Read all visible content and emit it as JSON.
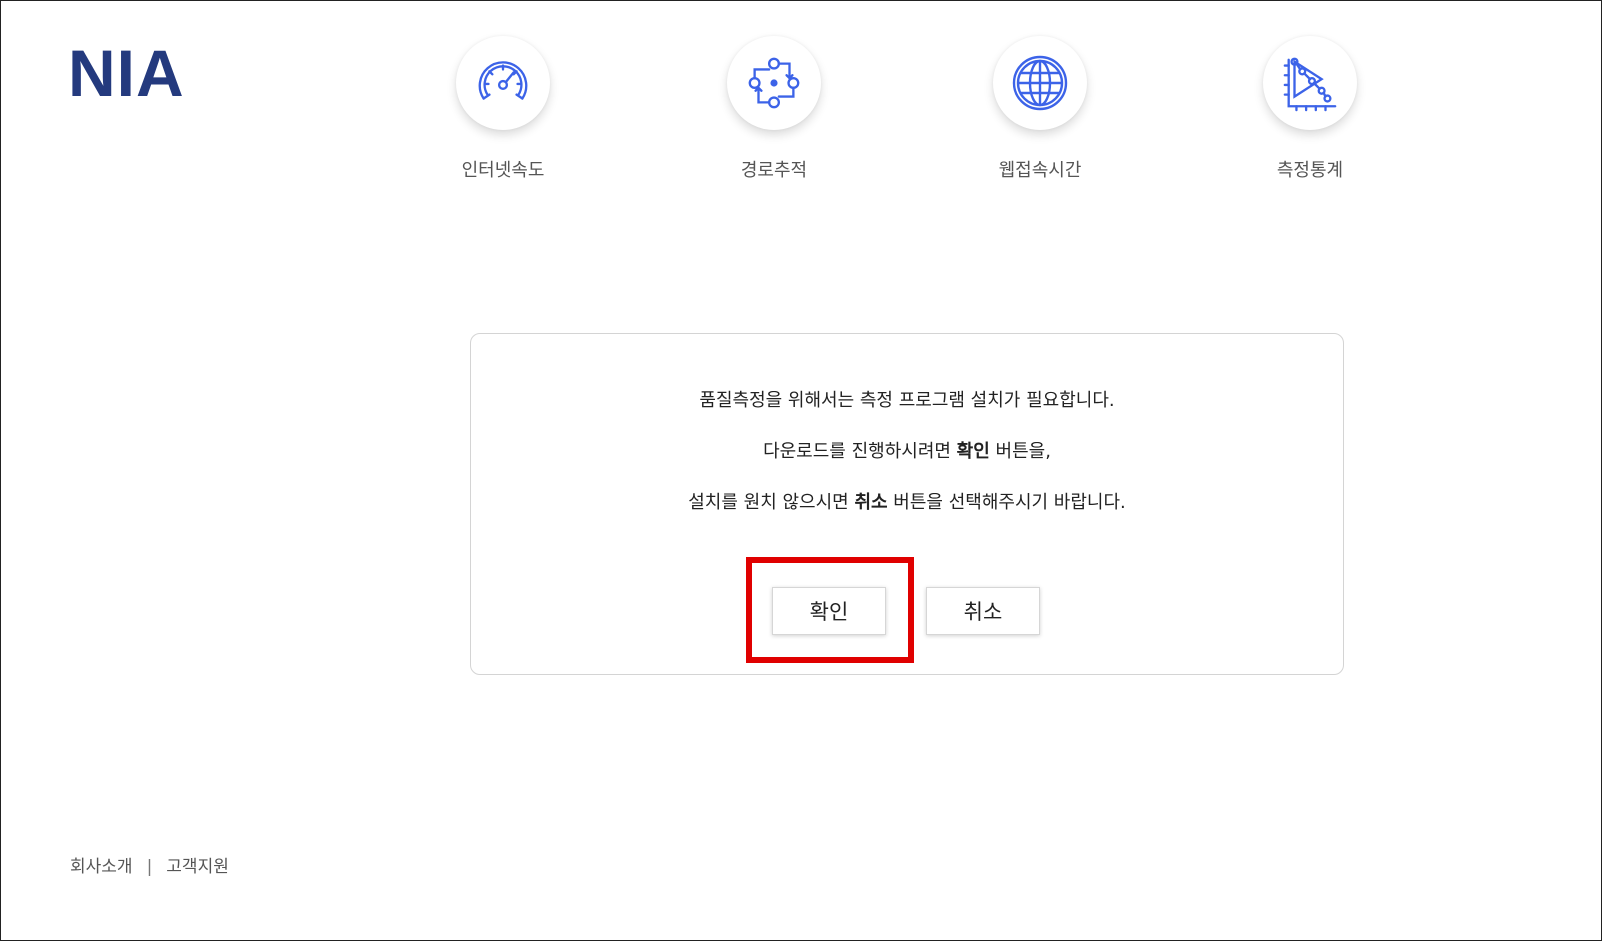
{
  "header": {
    "logo_text": "NIA",
    "nav": [
      {
        "label": "인터넷속도",
        "icon": "speedometer-icon"
      },
      {
        "label": "경로추적",
        "icon": "route-trace-icon"
      },
      {
        "label": "웹접속시간",
        "icon": "globe-icon"
      },
      {
        "label": "측정통계",
        "icon": "statistics-chart-icon"
      }
    ]
  },
  "dialog": {
    "line1": "품질측정을 위해서는 측정 프로그램 설치가 필요합니다.",
    "line2_pre": "다운로드를 진행하시려면 ",
    "line2_bold": "확인",
    "line2_post": " 버튼을,",
    "line3_pre": "설치를 원치 않으시면 ",
    "line3_bold": "취소",
    "line3_post": " 버튼을 선택해주시기 바랍니다.",
    "confirm_label": "확인",
    "cancel_label": "취소"
  },
  "footer": {
    "links": [
      "회사소개",
      "고객지원"
    ],
    "separator": "|"
  },
  "colors": {
    "logo": "#243a7e",
    "icon_blue": "#3c63e8",
    "highlight": "#e00000"
  }
}
